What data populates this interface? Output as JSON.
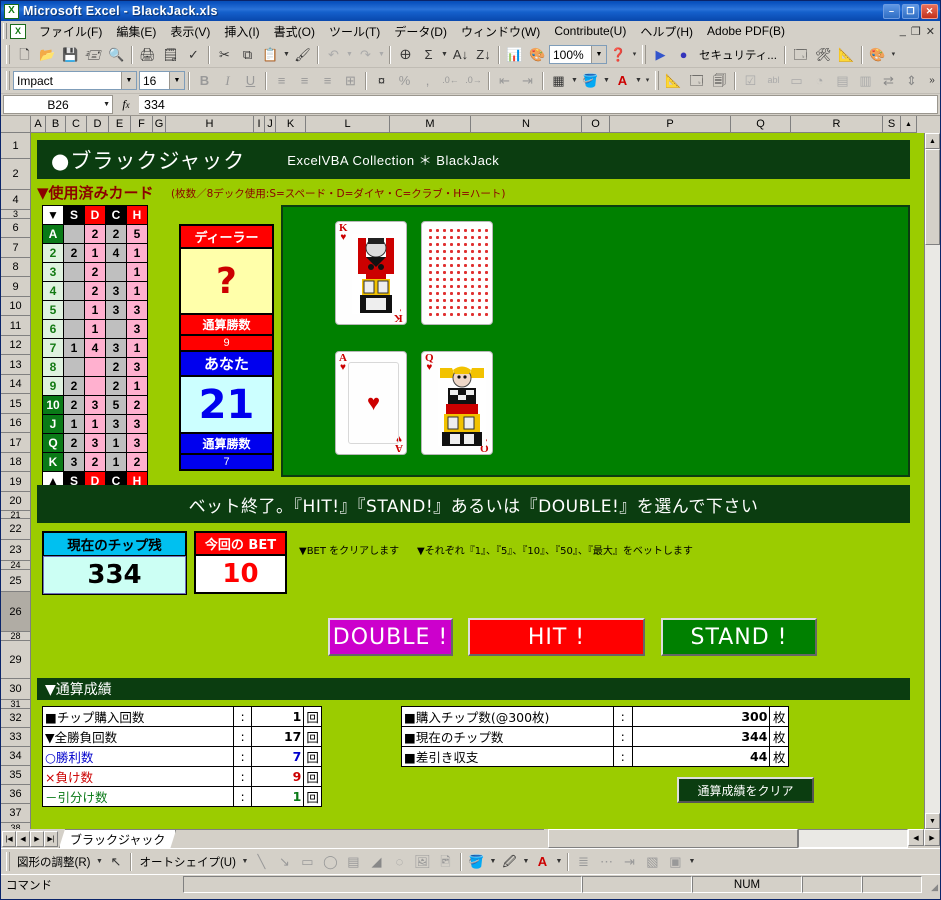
{
  "window": {
    "title": "Microsoft Excel - BlackJack.xls",
    "app_icon": "excel-icon",
    "minimize": "–",
    "maximize": "❐",
    "close": "✕",
    "doc_minimize": "_",
    "doc_restore": "❐",
    "doc_close": "✕"
  },
  "menubar": {
    "items": [
      "ファイル(F)",
      "編集(E)",
      "表示(V)",
      "挿入(I)",
      "書式(O)",
      "ツール(T)",
      "データ(D)",
      "ウィンドウ(W)",
      "Contribute(U)",
      "ヘルプ(H)",
      "Adobe PDF(B)"
    ]
  },
  "toolbar": {
    "zoom_value": "100%",
    "security_label": "セキュリティ...",
    "font_name": "Impact",
    "font_size": "16",
    "overflow": "»"
  },
  "formulabar": {
    "name_box": "B26",
    "fx_label": "fx",
    "formula_value": "334"
  },
  "grid": {
    "columns": [
      "A",
      "B",
      "C",
      "D",
      "E",
      "F",
      "G",
      "H",
      "I",
      "J",
      "K",
      "L",
      "M",
      "N",
      "O",
      "P",
      "Q",
      "R",
      "S"
    ],
    "rows": [
      "1",
      "2",
      "4",
      "3",
      "6",
      "7",
      "8",
      "9",
      "10",
      "11",
      "12",
      "13",
      "14",
      "15",
      "16",
      "17",
      "18",
      "19",
      "20",
      "21",
      "22",
      "23",
      "24",
      "25",
      "26",
      "28",
      "29",
      "30",
      "31",
      "32",
      "33",
      "34",
      "35",
      "36",
      "37",
      "38"
    ],
    "selected_row": "26"
  },
  "game": {
    "title": "●ブラックジャック",
    "subtitle": "ExcelVBA Collection ＊ BlackJack",
    "section_used_cards": "▼使用済みカード",
    "section_used_cards_note": "(枚数／8デック使用:S=スペード・D=ダイヤ・C=クラブ・H=ハート)",
    "card_table": {
      "corner_top": "▼",
      "corner_bottom": "▲",
      "suits": [
        "S",
        "D",
        "C",
        "H"
      ],
      "rows": [
        {
          "rank": "A",
          "counts": [
            "",
            "2",
            "2",
            "5"
          ]
        },
        {
          "rank": "2",
          "counts": [
            "2",
            "1",
            "4",
            "1"
          ]
        },
        {
          "rank": "3",
          "counts": [
            "",
            "2",
            "",
            "1"
          ]
        },
        {
          "rank": "4",
          "counts": [
            "",
            "2",
            "3",
            "1"
          ]
        },
        {
          "rank": "5",
          "counts": [
            "",
            "1",
            "3",
            "3"
          ]
        },
        {
          "rank": "6",
          "counts": [
            "",
            "1",
            "",
            "3"
          ]
        },
        {
          "rank": "7",
          "counts": [
            "1",
            "4",
            "3",
            "1"
          ]
        },
        {
          "rank": "8",
          "counts": [
            "",
            "",
            "2",
            "3"
          ]
        },
        {
          "rank": "9",
          "counts": [
            "2",
            "",
            "2",
            "1"
          ]
        },
        {
          "rank": "10",
          "counts": [
            "2",
            "3",
            "5",
            "2"
          ]
        },
        {
          "rank": "J",
          "counts": [
            "1",
            "1",
            "3",
            "3"
          ]
        },
        {
          "rank": "Q",
          "counts": [
            "2",
            "3",
            "1",
            "3"
          ]
        },
        {
          "rank": "K",
          "counts": [
            "3",
            "2",
            "1",
            "2"
          ]
        }
      ]
    },
    "dealer": {
      "label": "ディーラー",
      "hand_value": "?",
      "wins_label": "通算勝数",
      "wins": "9"
    },
    "player": {
      "label": "あなた",
      "hand_value": "21",
      "wins_label": "通算勝数",
      "wins": "7"
    },
    "cards": [
      {
        "position": "dealer-1",
        "rank": "K",
        "suit": "♥",
        "face_down": false
      },
      {
        "position": "dealer-2",
        "rank": "",
        "suit": "",
        "face_down": true
      },
      {
        "position": "player-1",
        "rank": "A",
        "suit": "♥",
        "face_down": false
      },
      {
        "position": "player-2",
        "rank": "Q",
        "suit": "♥",
        "face_down": false
      }
    ],
    "message": "ベット終了。『HIT!』『STAND!』あるいは『DOUBLE!』を選んで下さい",
    "chips": {
      "balance_label": "現在のチップ残",
      "balance_value": "334",
      "bet_label": "今回の BET",
      "bet_value": "10"
    },
    "hints": [
      "▼BET をクリアします",
      "▼それぞれ『1』、『5』、『10』、『50』、『最大』をベットします"
    ],
    "actions": [
      {
        "label": "DOUBLE !",
        "color": "#cc00cc"
      },
      {
        "label": "HIT !",
        "color": "#ff0000"
      },
      {
        "label": "STAND !",
        "color": "#008000"
      }
    ],
    "results_header": "▼通算成績",
    "results_left": [
      {
        "marker": "■",
        "label": "チップ購入回数",
        "sep": ":",
        "value": "1",
        "unit": "回",
        "color": "#000000"
      },
      {
        "marker": "▼",
        "label": "全勝負回数",
        "sep": ":",
        "value": "17",
        "unit": "回",
        "color": "#000000"
      },
      {
        "marker": "○",
        "label": "勝利数",
        "sep": ":",
        "value": "7",
        "unit": "回",
        "color": "#0000cc"
      },
      {
        "marker": "×",
        "label": "負け数",
        "sep": ":",
        "value": "9",
        "unit": "回",
        "color": "#cc0000"
      },
      {
        "marker": "－",
        "label": "引分け数",
        "sep": ":",
        "value": "1",
        "unit": "回",
        "color": "#0a7a17"
      }
    ],
    "results_right": [
      {
        "marker": "■",
        "label": "購入チップ数(@300枚)",
        "sep": ":",
        "value": "300",
        "unit": "枚"
      },
      {
        "marker": "■",
        "label": "現在のチップ数",
        "sep": ":",
        "value": "344",
        "unit": "枚"
      },
      {
        "marker": "■",
        "label": "差引き収支",
        "sep": ":",
        "value": "44",
        "unit": "枚"
      }
    ],
    "clear_button": "通算成績をクリア"
  },
  "sheet_tabs": {
    "tabs": [
      "ブラックジャック"
    ],
    "nav_first": "|◀",
    "nav_prev": "◀",
    "nav_next": "▶",
    "nav_last": "▶|"
  },
  "drawbar": {
    "shape_menu": "図形の調整(R)",
    "autoshape_menu": "オートシェイプ(U)"
  },
  "statusbar": {
    "mode": "コマンド",
    "num_lock": "NUM"
  },
  "colors": {
    "sheet_background": "#9bcc00",
    "felt_green": "#008000",
    "banner_green": "#0b3d10",
    "dealer_red": "#ff0000",
    "player_blue": "#0000ee",
    "pink": "#ffb0cf",
    "gray": "#bfbfbf"
  }
}
